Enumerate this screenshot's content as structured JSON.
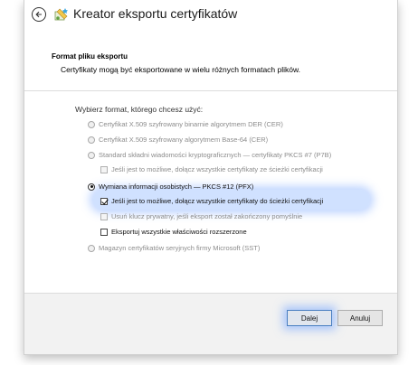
{
  "window": {
    "title": "Kreator eksportu certyfikatów"
  },
  "header": {
    "section_title": "Format pliku eksportu",
    "section_desc": "Certyfikaty mogą być eksportowane w wielu różnych formatach plików."
  },
  "form": {
    "choose_label": "Wybierz format, którego chcesz użyć:",
    "options": [
      {
        "label": "Certyfikat X.509 szyfrowany binarnie algorytmem DER (CER)",
        "kind": "radio",
        "checked": false,
        "enabled": false
      },
      {
        "label": "Certyfikat X.509 szyfrowany algorytmem Base-64 (CER)",
        "kind": "radio",
        "checked": false,
        "enabled": false
      },
      {
        "label": "Standard składni wiadomości kryptograficznych — certyfikaty PKCS #7 (P7B)",
        "kind": "radio",
        "checked": false,
        "enabled": false
      },
      {
        "label": "Jeśli jest to możliwe, dołącz wszystkie certyfikaty ze ścieżki certyfikacji",
        "kind": "check",
        "checked": false,
        "enabled": false
      },
      {
        "label": "Wymiana informacji osobistych — PKCS #12 (PFX)",
        "kind": "radio",
        "checked": true,
        "enabled": true
      },
      {
        "label": "Jeśli jest to możliwe, dołącz wszystkie certyfikaty do ścieżki certyfikacji",
        "kind": "check",
        "checked": true,
        "enabled": true
      },
      {
        "label": "Usuń klucz prywatny, jeśli eksport został zakończony pomyślnie",
        "kind": "check",
        "checked": false,
        "enabled": true
      },
      {
        "label": "Eksportuj wszystkie właściwości rozszerzone",
        "kind": "check",
        "checked": false,
        "enabled": true
      },
      {
        "label": "Magazyn certyfikatów seryjnych firmy Microsoft (SST)",
        "kind": "radio",
        "checked": false,
        "enabled": false
      }
    ]
  },
  "footer": {
    "next_label": "Dalej",
    "cancel_label": "Anuluj"
  },
  "icons": {
    "back": "back-arrow-icon",
    "app": "certificate-wizard-icon"
  },
  "colors": {
    "highlight": "#78aaff",
    "button_border_focus": "#4a7fc1"
  }
}
